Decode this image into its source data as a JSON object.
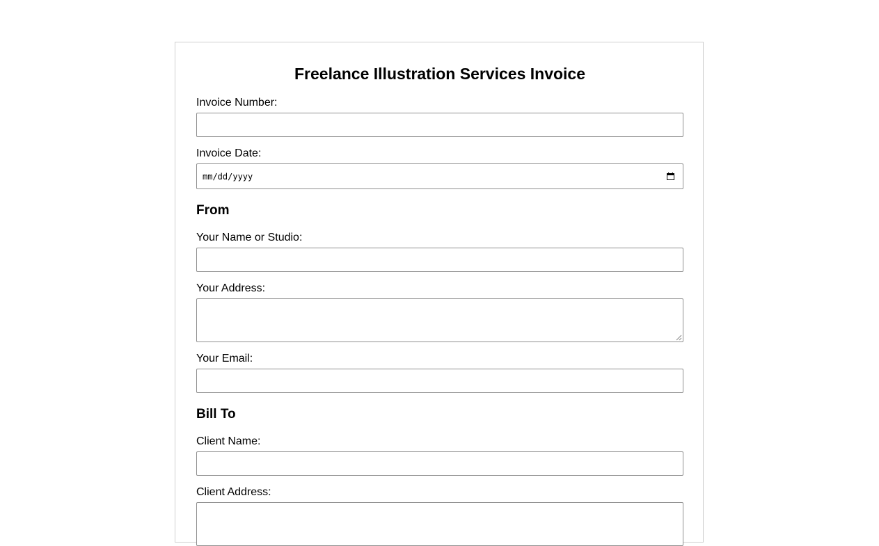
{
  "form": {
    "title": "Freelance Illustration Services Invoice",
    "invoice_number": {
      "label": "Invoice Number:",
      "value": ""
    },
    "invoice_date": {
      "label": "Invoice Date:",
      "placeholder": "mm/dd/yyyy",
      "icon": "calendar-icon"
    },
    "from": {
      "heading": "From",
      "name": {
        "label": "Your Name or Studio:",
        "value": ""
      },
      "address": {
        "label": "Your Address:",
        "value": ""
      },
      "email": {
        "label": "Your Email:",
        "value": ""
      }
    },
    "bill_to": {
      "heading": "Bill To",
      "client_name": {
        "label": "Client Name:",
        "value": ""
      },
      "client_address": {
        "label": "Client Address:",
        "value": ""
      }
    }
  }
}
